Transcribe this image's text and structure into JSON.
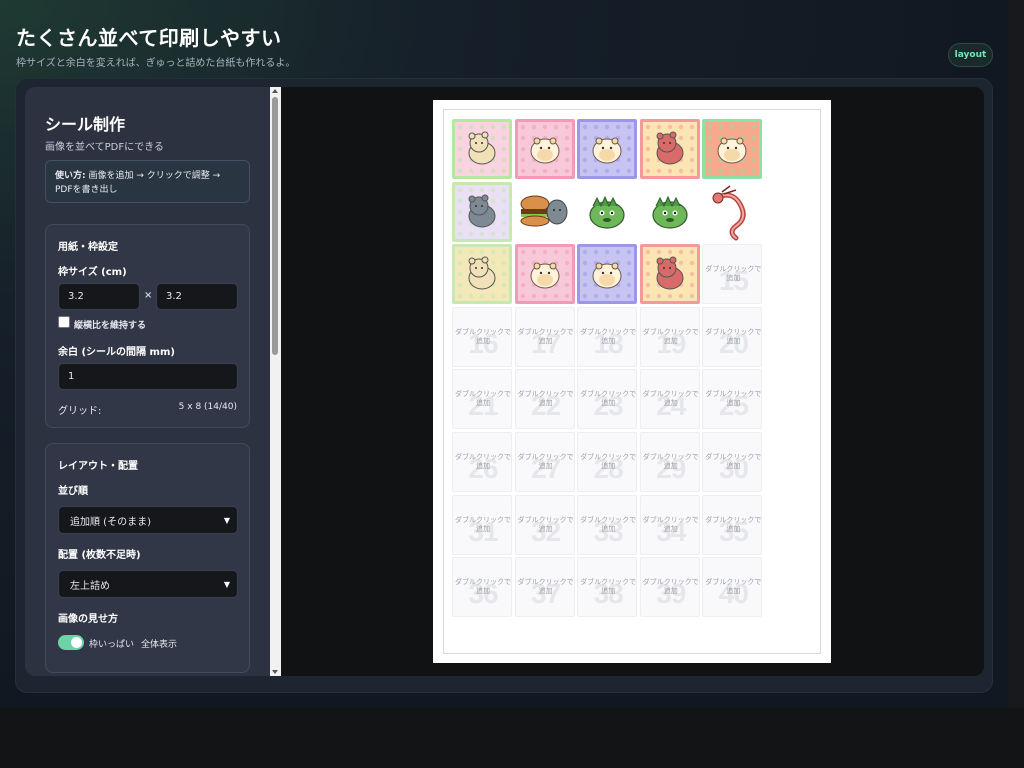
{
  "header": {
    "title": "たくさん並べて印刷しやすい",
    "subtitle": "枠サイズと余白を変えれば、ぎゅっと詰めた台紙も作れるよ。",
    "layout_button": "layout"
  },
  "sidebar": {
    "title": "シール制作",
    "subtitle": "画像を並べてPDFにできる",
    "howto_label": "使い方:",
    "howto_text": "画像を追加 → クリックで調整 → PDFを書き出し",
    "paper_card": {
      "heading": "用紙・枠設定",
      "frame_size_label": "枠サイズ (cm)",
      "width_value": "3.2",
      "height_value": "3.2",
      "times": "×",
      "keep_ratio_label": "縦横比を維持する",
      "keep_ratio_checked": false,
      "margin_label": "余白 (シールの間隔 mm)",
      "margin_value": "1",
      "grid_label": "グリッド:",
      "grid_value": "5 x 8 (14/40)"
    },
    "layout_card": {
      "heading": "レイアウト・配置",
      "order_label": "並び順",
      "order_value": "追加順 (そのまま)",
      "placement_label": "配置 (枚数不足時)",
      "placement_value": "左上詰め",
      "display_label": "画像の見せ方",
      "toggle_on_label": "枠いっぱい",
      "toggle_off_label": "全体表示",
      "toggle_state": true
    }
  },
  "sheet": {
    "columns": 5,
    "rows": 8,
    "filled_count": 14,
    "empty_hint": "ダブルクリックで追加",
    "stickers": [
      {
        "bg": "#f9d3e0",
        "accent": "#b6e6a6",
        "animal": "mouse-icon"
      },
      {
        "bg": "#f6c8d8",
        "accent": "#f29bb8",
        "animal": "hamster-icon"
      },
      {
        "bg": "#c7c4f2",
        "accent": "#9d98e6",
        "animal": "hamster-icon"
      },
      {
        "bg": "#fbe6b3",
        "accent": "#f49a9a",
        "animal": "cat-icon"
      },
      {
        "bg": "#f6a98c",
        "accent": "#8fe0a3",
        "animal": "hamster-icon"
      },
      {
        "bg": "#e9e0f4",
        "accent": "#c7e8b0",
        "animal": "gray-cat-icon"
      },
      {
        "bg": "#ffffff",
        "accent": "#ffffff",
        "animal": "burger-cat-icon"
      },
      {
        "bg": "#ffffff",
        "accent": "#ffffff",
        "animal": "green-dino-icon"
      },
      {
        "bg": "#ffffff",
        "accent": "#ffffff",
        "animal": "green-dino-icon"
      },
      {
        "bg": "#ffffff",
        "accent": "#ffffff",
        "animal": "dragon-icon"
      },
      {
        "bg": "#f3e8b8",
        "accent": "#c7e8b0",
        "animal": "mouse-icon"
      },
      {
        "bg": "#f6c8d8",
        "accent": "#f29bb8",
        "animal": "hamster-icon"
      },
      {
        "bg": "#c7c4f2",
        "accent": "#9d98e6",
        "animal": "hamster-icon"
      },
      {
        "bg": "#fbe6b3",
        "accent": "#f49a9a",
        "animal": "cat-icon"
      }
    ]
  },
  "colors": {
    "accent_green": "#6bd3a8",
    "sidebar_bg": "#2d3240",
    "card_bg": "#313747"
  }
}
